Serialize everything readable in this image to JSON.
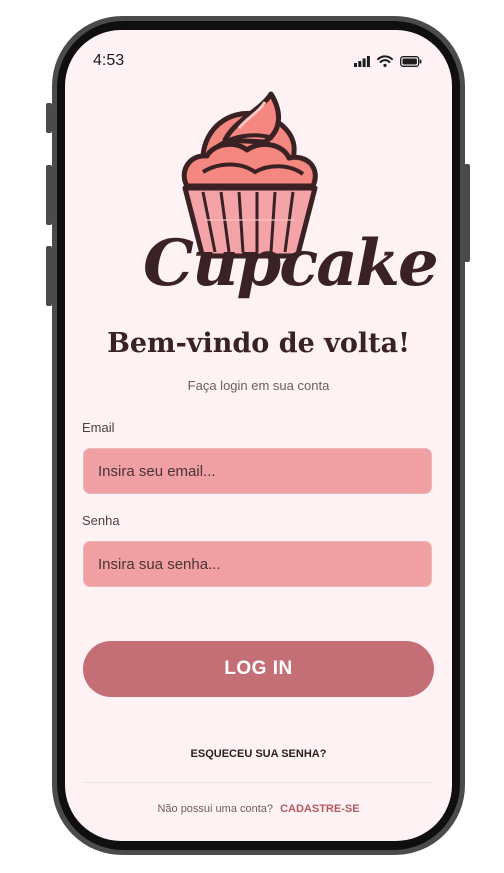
{
  "status": {
    "time": "4:53"
  },
  "brand": {
    "logo_text": "Cupcake"
  },
  "login": {
    "title": "Bem-vindo de volta!",
    "subtitle": "Faça login em sua conta",
    "email_label": "Email",
    "email_placeholder": "Insira seu email...",
    "password_label": "Senha",
    "password_placeholder": "Insira sua senha...",
    "submit_label": "LOG IN",
    "forgot_label": "ESQUECEU SUA SENHA?",
    "signup_prompt": "Não possui uma conta?",
    "signup_link": "CADASTRE-SE"
  },
  "colors": {
    "background": "#fff2f4",
    "input_fill": "#f09fa2",
    "button_fill": "#c46f76",
    "title_text": "#3a2224",
    "link_accent": "#b25a62"
  },
  "icons": [
    "signal-icon",
    "wifi-icon",
    "battery-icon",
    "cupcake-logo-icon"
  ]
}
